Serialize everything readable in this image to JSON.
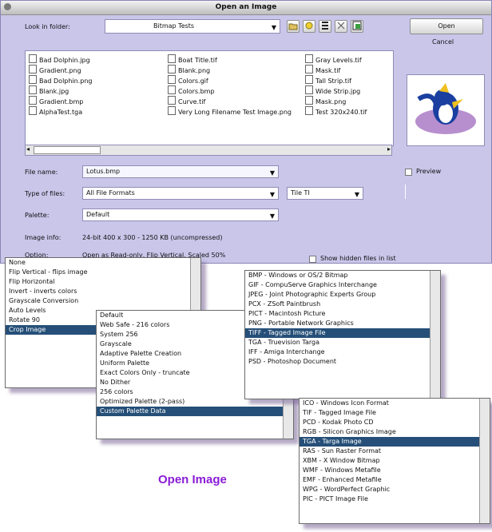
{
  "window": {
    "title": "Open an Image",
    "close_icon": "close-dot-icon"
  },
  "toolbar": {
    "look_in_label": "Look in folder:",
    "folder": "Bitmap Tests",
    "icons": [
      "up-folder-icon",
      "new-folder-icon",
      "list-view-icon",
      "detail-view-icon",
      "preview-icon"
    ],
    "open_label": "Open",
    "cancel_label": "Cancel"
  },
  "files": {
    "col1": [
      "Bad Dolphin.jpg",
      "Gradient.png",
      "Bad Dolphin.png",
      "Blank.jpg",
      "Gradient.bmp",
      "AlphaTest.tga"
    ],
    "col2": [
      "Boat Title.tif",
      "Blank.png",
      "Colors.gif",
      "Colors.bmp",
      "Curve.tif",
      "Very Long Filename Test Image.png"
    ],
    "col3": [
      "Gray Levels.tif",
      "Mask.tif",
      "Tall Strip.tif",
      "Wide Strip.jpg",
      "Mask.png",
      "Test 320x240.tif"
    ]
  },
  "fields": {
    "file_name_label": "File name:",
    "file_name_value": "Lotus.bmp",
    "file_type_label": "Type of files:",
    "file_type_value": "All File Formats",
    "encoding_value": "Tile TI",
    "color_label": "Palette:",
    "color_value": "Default",
    "preview_label": "Preview",
    "image_info_label": "Image info:",
    "image_info_value": "24-bit 400 x 300 - 1250 KB (uncompressed)",
    "options_label": "Option:",
    "options_value": "Open as Read-only, Flip Vertical, Scaled 50%",
    "show_all_label": "Show hidden files in list"
  },
  "popups": {
    "options": {
      "items": [
        "None",
        "Flip Vertical - flips image",
        "Flip Horizontal",
        "Invert - inverts colors",
        "Grayscale Conversion",
        "Auto Levels",
        "Rotate 90",
        "Crop Image"
      ],
      "selected": 7
    },
    "color": {
      "items": [
        "Default",
        "Web Safe - 216 colors",
        "System 256",
        "Grayscale",
        "Adaptive Palette Creation",
        "Uniform Palette",
        "Exact Colors Only - truncate",
        "No Dither",
        "256 colors",
        "Optimized Palette (2-pass)",
        "Custom Palette Data"
      ],
      "selected": 10
    },
    "encoding": {
      "items": [
        "BMP - Windows or OS/2 Bitmap",
        "GIF - CompuServe Graphics Interchange",
        "JPEG - Joint Photographic Experts Group",
        "PCX - ZSoft Paintbrush",
        "PICT - Macintosh Picture",
        "PNG - Portable Network Graphics",
        "TIFF - Tagged Image File",
        "TGA - Truevision Targa",
        "IFF - Amiga Interchange",
        "PSD - Photoshop Document"
      ],
      "selected": 6
    },
    "format": {
      "items": [
        "ICO - Windows Icon Format",
        "TIF - Tagged Image File",
        "PCD - Kodak Photo CD",
        "RGB - Silicon Graphics Image",
        "TGA - Targa Image",
        "RAS - Sun Raster Format",
        "XBM - X Window Bitmap",
        "WMF - Windows Metafile",
        "EMF - Enhanced Metafile",
        "WPG - WordPerfect Graphic",
        "PIC - PICT Image File"
      ],
      "selected": 4
    }
  },
  "caption": "Open Image",
  "colors": {
    "accent": "#8a1cd6",
    "selection": "#254f78",
    "window_bg": "#c9c6ea"
  }
}
